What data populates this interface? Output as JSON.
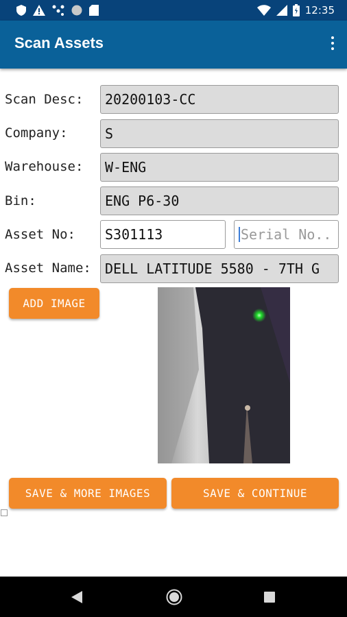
{
  "status": {
    "time": "12:35"
  },
  "appbar": {
    "title": "Scan Assets"
  },
  "form": {
    "scan_desc": {
      "label": "Scan Desc:",
      "value": "20200103-CC"
    },
    "company": {
      "label": "Company:",
      "value": "S"
    },
    "warehouse": {
      "label": "Warehouse:",
      "value": "W-ENG"
    },
    "bin": {
      "label": "Bin:",
      "value": "ENG P6-30"
    },
    "asset_no": {
      "label": "Asset No:",
      "value": "S301113"
    },
    "serial_no": {
      "placeholder": "Serial No.."
    },
    "asset_name": {
      "label": "Asset Name:",
      "value": "DELL LATITUDE 5580 - 7TH G"
    }
  },
  "buttons": {
    "add_image": "ADD IMAGE",
    "save_more_images": "SAVE & MORE IMAGES",
    "save_continue": "SAVE & CONTINUE"
  },
  "colors": {
    "status_bar": "#08437a",
    "app_bar": "#0a6199",
    "button": "#f28a2a",
    "field_disabled": "#dcdcdc"
  },
  "icons": [
    "shield-icon",
    "warning-icon",
    "network-icon",
    "circle-icon",
    "sim-icon",
    "wifi-icon",
    "signal-icon",
    "battery-icon",
    "overflow-menu-icon",
    "back-icon",
    "home-icon",
    "recents-icon"
  ]
}
